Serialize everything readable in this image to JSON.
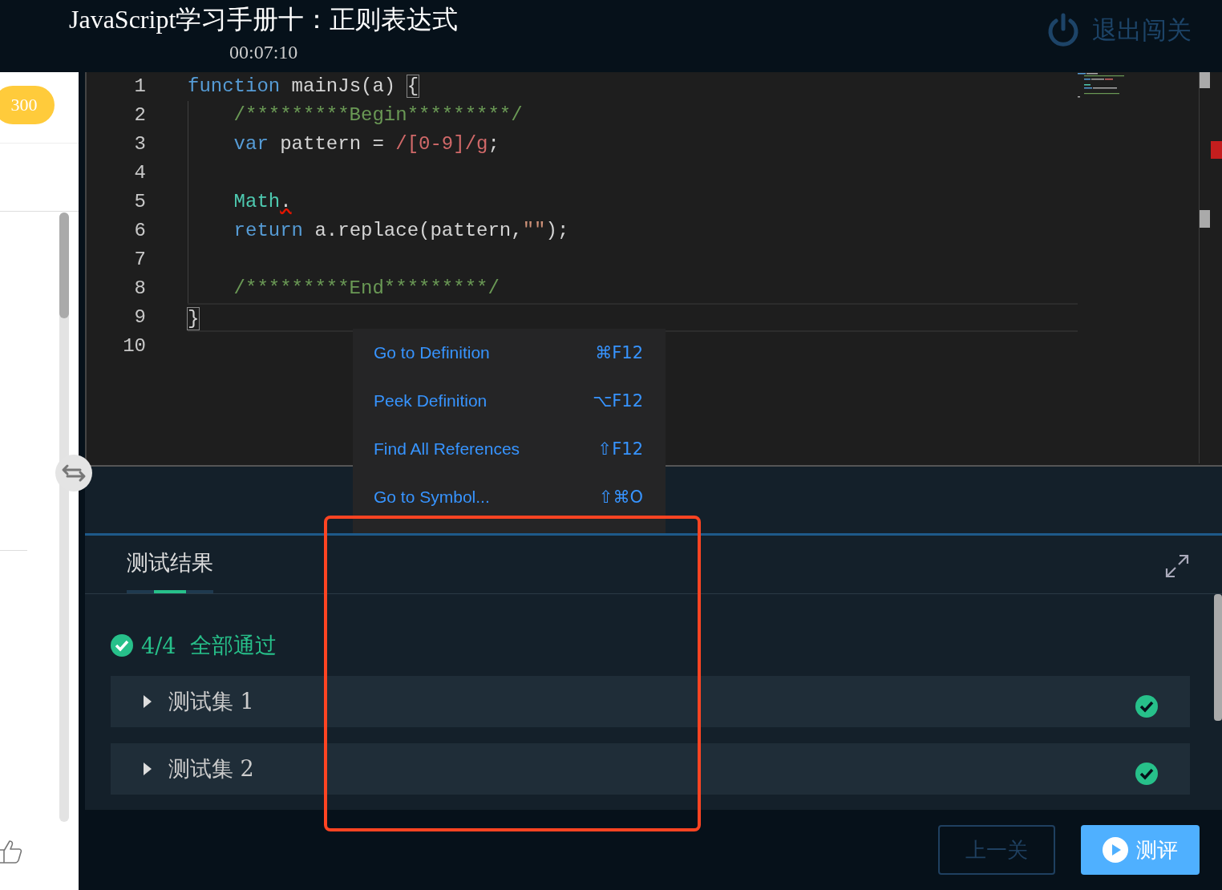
{
  "header": {
    "title": "JavaScript学习手册十：正则表达式",
    "timer": "00:07:10",
    "exit_label": "退出闯关"
  },
  "sidebar": {
    "score": "300"
  },
  "editor": {
    "lines": [
      {
        "number": "1",
        "tokens": [
          {
            "text": "function",
            "kind": "keyword"
          },
          {
            "text": " mainJs(a) ",
            "kind": "plain"
          },
          {
            "text": "{",
            "kind": "bracket"
          }
        ],
        "children": [
          {
            "number": "2",
            "tokens": [
              {
                "text": "/*********Begin*********/",
                "kind": "comment"
              }
            ]
          },
          {
            "number": "3",
            "tokens": [
              {
                "text": "var",
                "kind": "keyword"
              },
              {
                "text": " pattern = ",
                "kind": "plain"
              },
              {
                "text": "/[0-9]/g",
                "kind": "regex"
              },
              {
                "text": ";",
                "kind": "plain"
              }
            ]
          },
          {
            "number": "4"
          },
          {
            "number": "5",
            "tokens": [
              {
                "text": "Math",
                "kind": "type"
              },
              {
                "text": ".",
                "kind": "error"
              }
            ]
          },
          {
            "number": "6",
            "tokens": [
              {
                "text": "return",
                "kind": "keyword"
              },
              {
                "text": " a.replace(pattern,",
                "kind": "plain"
              },
              {
                "text": "\"\"",
                "kind": "string"
              },
              {
                "text": ");",
                "kind": "plain"
              }
            ]
          },
          {
            "number": "7"
          },
          {
            "number": "8",
            "tokens": [
              {
                "text": "/*********End*********/",
                "kind": "comment"
              }
            ]
          }
        ]
      },
      {
        "number": "9",
        "current": true,
        "tokens": [
          {
            "text": "}",
            "kind": "bracket"
          }
        ]
      },
      {
        "number": "10"
      }
    ]
  },
  "context_menu": [
    {
      "label": "Go to Definition",
      "shortcut": "⌘F12"
    },
    {
      "label": "Peek Definition",
      "shortcut": "⌥F12"
    },
    {
      "label": "Find All References",
      "shortcut": "⇧F12"
    },
    {
      "label": "Go to Symbol...",
      "shortcut": "⇧⌘O"
    }
  ],
  "results": {
    "tabs": [
      {
        "label": "测试结果",
        "selected": true
      }
    ],
    "summary": {
      "count": "4/4",
      "status": "全部通过",
      "passed": true
    },
    "test_sets": [
      {
        "label": "测试集 1",
        "passed": true,
        "expanded": false
      },
      {
        "label": "测试集 2",
        "passed": true,
        "expanded": false
      }
    ]
  },
  "buttons": [
    {
      "label": "上一关",
      "kind": "secondary"
    },
    {
      "label": "测评",
      "kind": "primary"
    }
  ]
}
